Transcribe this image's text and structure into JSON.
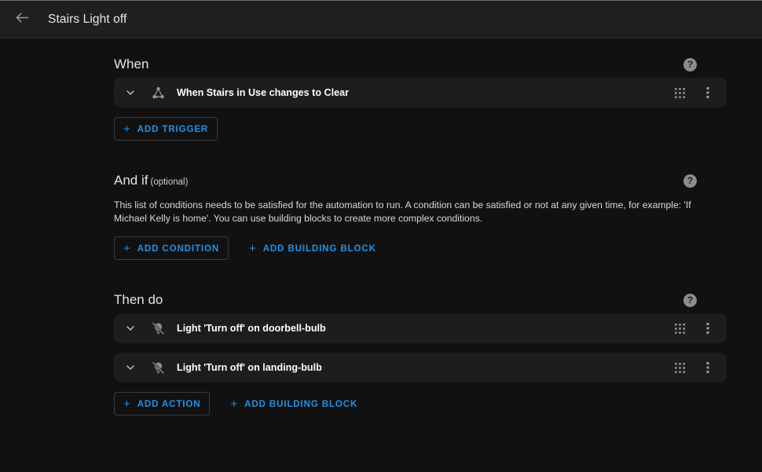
{
  "toolbar": {
    "back_icon": "arrow-left-icon",
    "title": "Stairs Light off"
  },
  "sections": {
    "when": {
      "title": "When",
      "help_label": "?",
      "triggers": [
        {
          "icon": "state-transition-icon",
          "title": "When Stairs in Use changes to Clear",
          "expand_icon": "chevron-down-icon",
          "drag_icon": "drag-grid-icon",
          "menu_icon": "overflow-menu-icon"
        }
      ],
      "add_button": "ADD TRIGGER"
    },
    "and_if": {
      "title": "And if",
      "optional": "(optional)",
      "help_label": "?",
      "description": "This list of conditions needs to be satisfied for the automation to run. A condition can be satisfied or not at any given time, for example: 'If Michael Kelly is home'. You can use building blocks to create more complex conditions.",
      "add_condition_button": "ADD CONDITION",
      "add_building_block_button": "ADD BUILDING BLOCK"
    },
    "then_do": {
      "title": "Then do",
      "help_label": "?",
      "actions": [
        {
          "icon": "lightbulb-off-icon",
          "title": "Light 'Turn off' on doorbell-bulb",
          "expand_icon": "chevron-down-icon",
          "drag_icon": "drag-grid-icon",
          "menu_icon": "overflow-menu-icon"
        },
        {
          "icon": "lightbulb-off-icon",
          "title": "Light 'Turn off' on landing-bulb",
          "expand_icon": "chevron-down-icon",
          "drag_icon": "drag-grid-icon",
          "menu_icon": "overflow-menu-icon"
        }
      ],
      "add_action_button": "ADD ACTION",
      "add_building_block_button": "ADD BUILDING BLOCK"
    }
  },
  "colors": {
    "accent": "#2391e6",
    "page_background": "#111111",
    "toolbar_background": "#1f1f1f",
    "card_background": "#1d1d1d"
  }
}
